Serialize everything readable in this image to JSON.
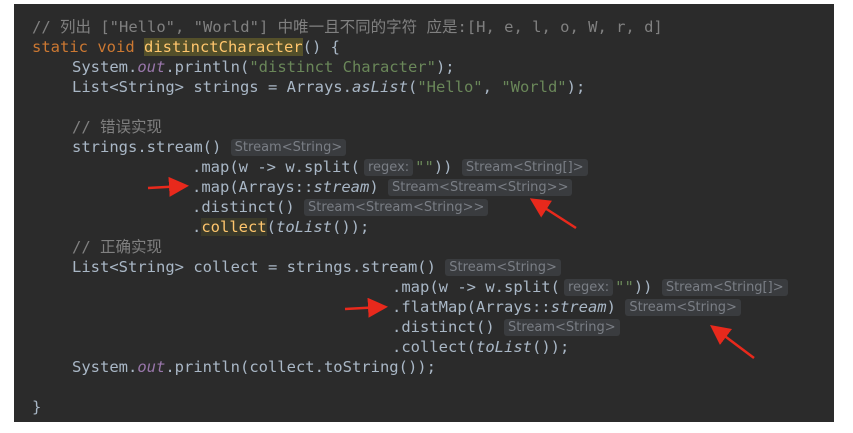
{
  "code": {
    "l1": "// 列出 [\"Hello\", \"World\"] 中唯一且不同的字符 应是:[H, e, l, o, W, r, d]",
    "l2": {
      "kw": "static void ",
      "name": "distinctCharacter",
      "rest": "() {"
    },
    "l3": {
      "a": "System.",
      "field": "out",
      "b": ".println(",
      "str": "\"distinct Character\"",
      "c": ");"
    },
    "l4": {
      "a": "List<String> strings = Arrays.",
      "method": "asList",
      "b": "(",
      "s1": "\"Hello\"",
      "sep": ", ",
      "s2": "\"World\"",
      "c": ");"
    },
    "l6": "// 错误实现",
    "l7": {
      "a": "strings.stream()",
      "hint": "Stream<String>"
    },
    "l8": {
      "a": ".map(w -> w.split(",
      "param": "regex:",
      "str": "\"\"",
      "b": "))",
      "hint": "Stream<String[]>"
    },
    "l9": {
      "a": ".map(Arrays::",
      "method": "stream",
      "b": ")",
      "hint": "Stream<Stream<String>>"
    },
    "l10": {
      "a": ".distinct()",
      "hint": "Stream<Stream<String>>"
    },
    "l11": {
      "a": ".",
      "collect": "collect",
      "b": "(",
      "method": "toList",
      "c": "());"
    },
    "l12": "// 正确实现",
    "l13": {
      "a": "List<String> collect = strings.stream()",
      "hint": "Stream<String>"
    },
    "l14": {
      "a": ".map(w -> w.split(",
      "param": "regex:",
      "str": "\"\"",
      "b": "))",
      "hint": "Stream<String[]>"
    },
    "l15": {
      "a": ".flatMap(Arrays::",
      "method": "stream",
      "b": ")",
      "hint": "Stream<String>"
    },
    "l16": {
      "a": ".distinct()",
      "hint": "Stream<String>"
    },
    "l17": {
      "a": ".collect(",
      "method": "toList",
      "b": "());"
    },
    "l18": {
      "a": "System.",
      "field": "out",
      "b": ".println(collect.toString());"
    },
    "l20": "}"
  },
  "colors": {
    "background": "#2b2b2b",
    "text": "#a9b7c6",
    "comment": "#808080",
    "keyword": "#cc7832",
    "string": "#6a8759",
    "field": "#9876aa",
    "annotation_arrow": "#e8291c"
  }
}
